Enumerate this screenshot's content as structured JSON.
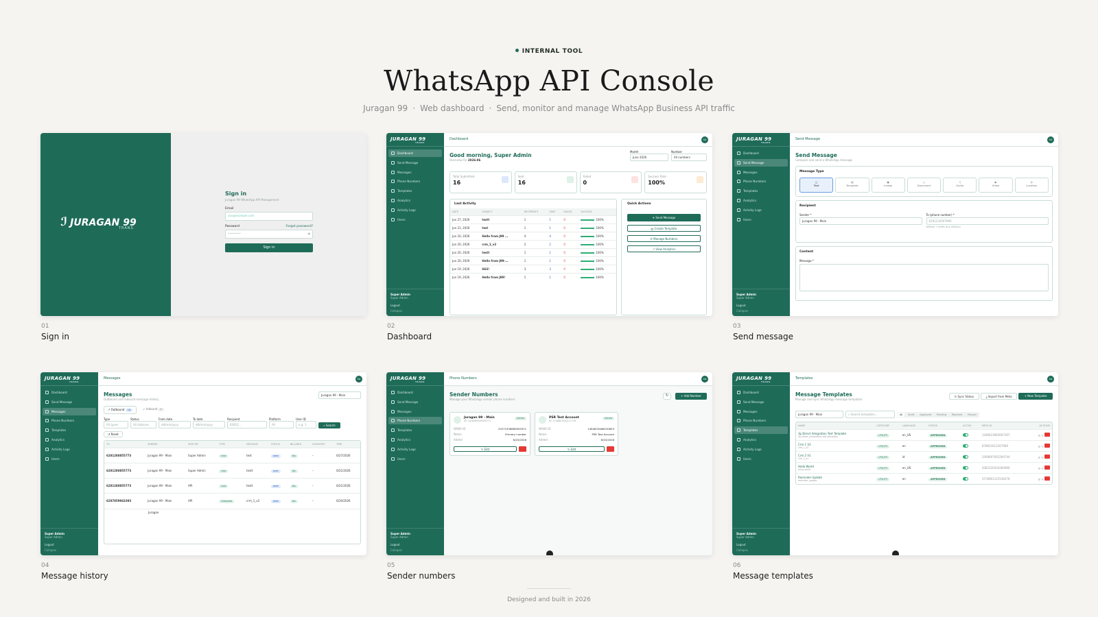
{
  "header": {
    "eyebrow": "INTERNAL TOOL",
    "title": "WhatsApp API Console",
    "sub_1": "Juragan 99",
    "sub_2": "Web dashboard",
    "sub_3": "Send, monitor and manage WhatsApp Business API traffic",
    "separator": "·"
  },
  "footer": {
    "text": "Designed and built in 2026"
  },
  "brand": {
    "name": "JURAGAN 99",
    "tag": "TRANS"
  },
  "nav": [
    "Dashboard",
    "Send Message",
    "Messages",
    "Phone Numbers",
    "Templates",
    "Analytics",
    "Activity Logs",
    "Users"
  ],
  "user": {
    "name": "Super Admin",
    "role": "Super Admin",
    "initials": "SA",
    "logout": "Logout",
    "collapse": "Collapse"
  },
  "captions": [
    {
      "num": "01",
      "label": "Sign in"
    },
    {
      "num": "02",
      "label": "Dashboard"
    },
    {
      "num": "03",
      "label": "Send message"
    },
    {
      "num": "04",
      "label": "Message history"
    },
    {
      "num": "05",
      "label": "Sender numbers"
    },
    {
      "num": "06",
      "label": "Message templates"
    }
  ],
  "signin": {
    "title": "Sign in",
    "subtitle": "Juragan 99 WhatsApp API Management",
    "email_label": "Email",
    "email_placeholder": "you@example.com",
    "password_label": "Password",
    "forgot": "Forgot password?",
    "password_mask": "••••••••",
    "button": "Sign in"
  },
  "dashboard": {
    "topbar": "Dashboard",
    "greeting": "Good morning, Super Admin",
    "overview_prefix": "Overview for",
    "overview_period": "2026-06",
    "month_label": "Month",
    "month_value": "June 2026",
    "number_label": "Number",
    "number_value": "All numbers",
    "stats": [
      {
        "label": "Total Submitted",
        "value": "16",
        "icon": "send-icon",
        "color": "#2d5db5"
      },
      {
        "label": "Sent",
        "value": "16",
        "icon": "check-icon",
        "color": "#2e7d5c"
      },
      {
        "label": "Failed",
        "value": "0",
        "icon": "alert-icon",
        "color": "#e53935"
      },
      {
        "label": "Success Rate",
        "value": "100%",
        "icon": "trend-icon",
        "color": "#e08a1e"
      }
    ],
    "activity_title": "Last Activity",
    "activity_cols": [
      "DATE",
      "SUBJECT",
      "RECIPIENTS",
      "SENT",
      "FAILED",
      "SUCCESS"
    ],
    "activity_rows": [
      [
        "Jun 27, 2026",
        "testt",
        "1",
        "1",
        "0",
        "100%"
      ],
      [
        "Jun 21, 2026",
        "test",
        "1",
        "1",
        "0",
        "100%"
      ],
      [
        "Jun 20, 2026",
        "Hello from J99 ...",
        "4",
        "4",
        "0",
        "100%"
      ],
      [
        "Jun 20, 2026",
        "crm_1_v2",
        "2",
        "2",
        "0",
        "100%"
      ],
      [
        "Jun 20, 2026",
        "testt",
        "1",
        "1",
        "0",
        "100%"
      ],
      [
        "Jun 20, 2026",
        "Hello from J99-...",
        "1",
        "1",
        "0",
        "100%"
      ],
      [
        "Jun 19, 2026",
        "Hiiii!",
        "3",
        "3",
        "0",
        "100%"
      ],
      [
        "Jun 19, 2026",
        "Hello from J99!",
        "1",
        "1",
        "0",
        "100%"
      ]
    ],
    "quick_title": "Quick Actions",
    "quick": [
      "Send Message",
      "Create Template",
      "Manage Numbers",
      "View Analytics"
    ]
  },
  "send": {
    "topbar": "Send Message",
    "title": "Send Message",
    "subtitle": "Compose and send a WhatsApp message",
    "type_title": "Message Type",
    "types": [
      "Text",
      "Template",
      "Image",
      "Document",
      "Audio",
      "Video",
      "Location"
    ],
    "recipient_title": "Recipient",
    "sender_label": "Sender *",
    "sender_value": "Juragan 99 - Main",
    "to_label": "To (phone number) *",
    "to_placeholder": "6281234567890",
    "to_hint": "Without + prefix (e.g. 628xxx)",
    "content_title": "Content",
    "message_label": "Message *"
  },
  "messages": {
    "topbar": "Messages",
    "title": "Messages",
    "subtitle": "Outbound and inbound message history",
    "sender_select": "Juragan 99 - Main",
    "tab_out": "Outbound",
    "tab_out_count": "16",
    "tab_in": "Inbound",
    "tab_in_count": "0",
    "filters": [
      {
        "label": "Type",
        "value": "All types"
      },
      {
        "label": "Status",
        "value": "All statuses"
      },
      {
        "label": "From date",
        "value": "dd/mm/yyyy"
      },
      {
        "label": "To date",
        "value": "dd/mm/yyyy"
      },
      {
        "label": "Recipient",
        "value": "62812..."
      },
      {
        "label": "Platform",
        "value": "All"
      },
      {
        "label": "User ID",
        "value": "e.g. 1"
      }
    ],
    "search": "Search",
    "reset": "Reset",
    "cols": [
      "TO",
      "SENDER",
      "SENT BY",
      "TYPE",
      "MESSAGE",
      "STATUS",
      "BILLABLE",
      "CATEGORY",
      "TIME"
    ],
    "rows": [
      {
        "to": "6281288855773",
        "sender": "Juragan 99 - Main",
        "by": "Super Admin",
        "type": "text",
        "msg": "test",
        "status": "sent",
        "bill": "No",
        "cat": "–",
        "time": "6/27/2026"
      },
      {
        "to": "6281288855773",
        "sender": "Juragan 99 - Main",
        "by": "Super Admin",
        "type": "text",
        "msg": "testt",
        "status": "sent",
        "bill": "No",
        "cat": "–",
        "time": "6/21/2026"
      },
      {
        "to": "6281288855773",
        "sender": "Juragan 99 - Main",
        "by": "API",
        "type": "text",
        "msg": "testt",
        "status": "sent",
        "bill": "No",
        "cat": "–",
        "time": "6/21/2026"
      },
      {
        "to": "6287859943393",
        "sender": "Juragan 99 - Main",
        "by": "API",
        "type": "template",
        "msg": "crm_1_v2",
        "status": "sent",
        "bill": "No",
        "cat": "–",
        "time": "6/20/2026"
      }
    ],
    "partial_sender": "Juragan"
  },
  "numbers": {
    "topbar": "Phone Numbers",
    "title": "Sender Numbers",
    "subtitle": "Manage your WhatsApp sender phone numbers",
    "add": "Add Number",
    "cards": [
      {
        "name": "Juragan 99 - Main",
        "id": "ID: 1028469509030771",
        "status": "Active",
        "waba_label": "WABA ID",
        "waba": "25271936889955971",
        "notes_label": "Notes",
        "notes": "Primary number",
        "added_label": "Added",
        "added": "6/20/2026",
        "edit": "Edit"
      },
      {
        "name": "PSR Test Account",
        "id": "ID: 1106807610127749",
        "status": "Active",
        "waba_label": "WABA ID",
        "waba": "1464633468230853",
        "notes_label": "Notes",
        "notes": "PSR Test Account",
        "added_label": "Added",
        "added": "6/20/2026",
        "edit": "Edit"
      }
    ]
  },
  "templates": {
    "topbar": "Templates",
    "title": "Message Templates",
    "subtitle": "Manage and sync WhatsApp message templates",
    "sync": "Sync Status",
    "import": "Import from Meta",
    "new": "New Template",
    "sender_select": "Juragan 99 - Main",
    "search_placeholder": "Search templates...",
    "filters": [
      "All",
      "Draft",
      "Approved",
      "Pending",
      "Rejected",
      "Paused"
    ],
    "cols": [
      "NAME",
      "CATEGORY",
      "LANGUAGE",
      "STATUS",
      "ACTIVE",
      "META ID",
      "ACTIONS"
    ],
    "rows": [
      {
        "name": "3p Direct Integration Test Template",
        "code": "3p_direct_integration_test_template",
        "cat": "UTILITY",
        "lang": "en_US",
        "status": "APPROVED",
        "meta": "1286623983697407"
      },
      {
        "name": "Crm 1 V2",
        "code": "crm_1_v2",
        "cat": "UTILITY",
        "lang": "en",
        "status": "APPROVED",
        "meta": "878824612267989"
      },
      {
        "name": "Crm 2 V1",
        "code": "crm_2_v1",
        "cat": "UTILITY",
        "lang": "id",
        "status": "APPROVED",
        "meta": "2408697002284744"
      },
      {
        "name": "Hello World",
        "code": "hello_world",
        "cat": "UTILITY",
        "lang": "en_US",
        "status": "APPROVED",
        "meta": "2082320434284966"
      },
      {
        "name": "Reminder Update",
        "code": "reminder_update",
        "cat": "UTILITY",
        "lang": "en",
        "status": "APPROVED",
        "meta": "2578061125546278"
      }
    ]
  }
}
